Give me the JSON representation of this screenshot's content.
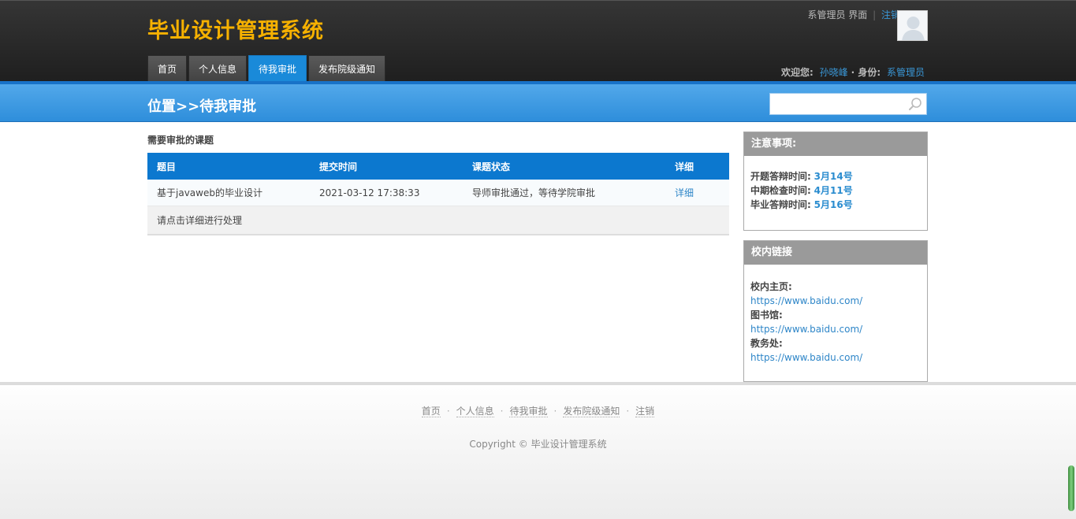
{
  "header": {
    "title": "毕业设计管理系统",
    "role_text": "系管理员 界面",
    "logout_label": "注销",
    "nav_tabs": [
      {
        "label": "首页"
      },
      {
        "label": "个人信息"
      },
      {
        "label": "待我审批"
      },
      {
        "label": "发布院级通知"
      }
    ],
    "active_tab_index": 2,
    "welcome_prefix": "欢迎您:",
    "user_name": "孙晓峰",
    "identity_prefix": "· 身份:",
    "identity_value": "系管理员"
  },
  "bar": {
    "breadcrumb": "位置>>待我审批",
    "search_placeholder": ""
  },
  "main": {
    "section_title": "需要审批的课题",
    "table": {
      "headers": [
        "题目",
        "提交时间",
        "课题状态",
        "详细"
      ],
      "rows": [
        [
          "基于javaweb的毕业设计",
          "2021-03-12 17:38:33",
          "导师审批通过，等待学院审批",
          "详细"
        ]
      ],
      "note": "请点击详细进行处理"
    }
  },
  "sidebar": {
    "notice": {
      "title": "注意事项:",
      "items": [
        {
          "label": "开题答辩时间:",
          "value": "3月14号"
        },
        {
          "label": "中期检查时间:",
          "value": "4月11号"
        },
        {
          "label": "毕业答辩时间:",
          "value": "5月16号"
        }
      ]
    },
    "links": {
      "title": "校内链接",
      "items": [
        {
          "label": "校内主页:",
          "url": "https://www.baidu.com/"
        },
        {
          "label": "图书馆:",
          "url": "https://www.baidu.com/"
        },
        {
          "label": "教务处:",
          "url": "https://www.baidu.com/"
        }
      ]
    }
  },
  "footer": {
    "links": [
      "首页",
      "个人信息",
      "待我审批",
      "发布院级通知",
      "注销"
    ],
    "copyright": "Copyright © 毕业设计管理系统"
  }
}
